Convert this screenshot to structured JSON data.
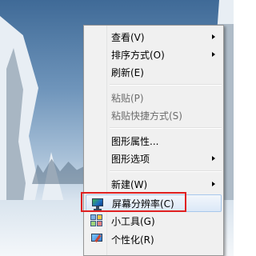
{
  "context_menu": {
    "items": [
      {
        "label": "查看(V)",
        "submenu": true,
        "disabled": false
      },
      {
        "label": "排序方式(O)",
        "submenu": true,
        "disabled": false
      },
      {
        "label": "刷新(E)",
        "submenu": false,
        "disabled": false
      },
      {
        "label": "粘贴(P)",
        "submenu": false,
        "disabled": true
      },
      {
        "label": "粘贴快捷方式(S)",
        "submenu": false,
        "disabled": true
      },
      {
        "label": "图形属性...",
        "submenu": false,
        "disabled": false
      },
      {
        "label": "图形选项",
        "submenu": true,
        "disabled": false
      },
      {
        "label": "新建(W)",
        "submenu": true,
        "disabled": false
      },
      {
        "label": "屏幕分辨率(C)",
        "submenu": false,
        "disabled": false,
        "highlighted": true,
        "icon": "monitor-icon"
      },
      {
        "label": "小工具(G)",
        "submenu": false,
        "disabled": false,
        "icon": "gadgets-icon"
      },
      {
        "label": "个性化(R)",
        "submenu": false,
        "disabled": false,
        "icon": "personalize-icon"
      }
    ]
  },
  "colors": {
    "highlight_box": "#e02020",
    "menu_background": "#f0f0f0",
    "disabled_text": "#6d6d6d"
  }
}
